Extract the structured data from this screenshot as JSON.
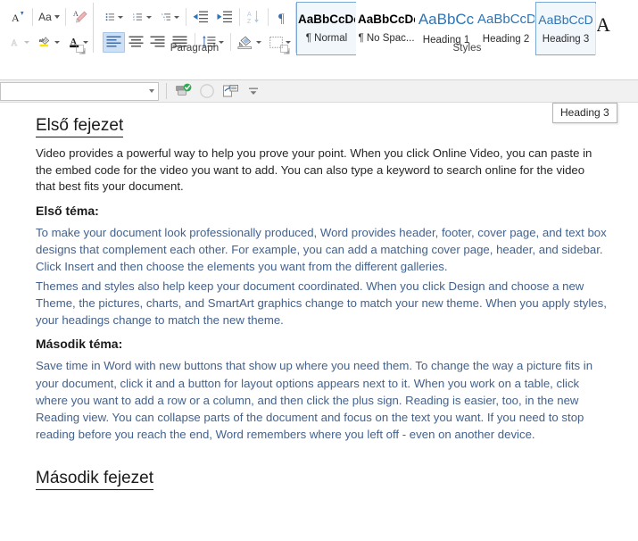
{
  "ribbon": {
    "font_group": {
      "buttons": [
        {
          "name": "grow-font-button",
          "label": "A",
          "icon": "grow-font-icon"
        },
        {
          "name": "change-case-button",
          "label": "Aa",
          "icon": "change-case-icon"
        },
        {
          "name": "clear-formatting-button",
          "label": "",
          "icon": "eraser-icon"
        },
        {
          "name": "text-effects-button",
          "label": "A",
          "icon": "text-effects-icon"
        },
        {
          "name": "text-highlight-color-button",
          "label": "ab",
          "icon": "highlighter-icon"
        },
        {
          "name": "font-color-button",
          "label": "A",
          "icon": "font-color-icon"
        }
      ]
    },
    "paragraph_group": {
      "caption": "Paragraph",
      "buttons": [
        {
          "name": "bullets-button",
          "icon": "bulleted-list-icon"
        },
        {
          "name": "numbering-button",
          "icon": "numbered-list-icon"
        },
        {
          "name": "multilevel-list-button",
          "icon": "multilevel-list-icon"
        },
        {
          "name": "decrease-indent-button",
          "icon": "decrease-indent-icon"
        },
        {
          "name": "increase-indent-button",
          "icon": "increase-indent-icon"
        },
        {
          "name": "sort-button",
          "icon": "sort-az-icon"
        },
        {
          "name": "show-formatting-marks-button",
          "icon": "pilcrow-icon"
        },
        {
          "name": "align-left-button",
          "icon": "align-left-icon"
        },
        {
          "name": "align-center-button",
          "icon": "align-center-icon"
        },
        {
          "name": "align-right-button",
          "icon": "align-right-icon"
        },
        {
          "name": "justify-button",
          "icon": "justify-icon"
        },
        {
          "name": "line-spacing-button",
          "icon": "line-spacing-icon"
        },
        {
          "name": "shading-button",
          "icon": "paint-bucket-icon"
        },
        {
          "name": "borders-button",
          "icon": "borders-icon"
        }
      ],
      "launcher_name": "paragraph-dialog-launcher"
    },
    "styles_group": {
      "caption": "Styles",
      "items": [
        {
          "preview": "AaBbCcDc",
          "label": "¶ Normal",
          "variant": "bold",
          "state": "hot"
        },
        {
          "preview": "AaBbCcDc",
          "label": "¶ No Spac...",
          "variant": "bold",
          "state": "idle"
        },
        {
          "preview": "AaBbCc",
          "label": "Heading 1",
          "variant": "h1",
          "state": "idle"
        },
        {
          "preview": "AaBbCcD",
          "label": "Heading 2",
          "variant": "h2",
          "state": "idle"
        },
        {
          "preview": "AaBbCcD",
          "label": "Heading 3",
          "variant": "h3",
          "state": "hot"
        },
        {
          "preview": "A",
          "label": "",
          "variant": "cut",
          "state": "idle"
        }
      ],
      "launcher_name": "styles-dialog-launcher"
    }
  },
  "toolbar2": {
    "combo_value": "",
    "combo_placeholder": "",
    "buttons": [
      {
        "name": "spelling-and-grammar-button",
        "icon": "spelling-check-icon"
      },
      {
        "name": "ellipse-shape-button",
        "icon": "circle-icon"
      },
      {
        "name": "insert-reference-button",
        "icon": "document-reference-icon"
      },
      {
        "name": "more-commands-button",
        "icon": "overflow-chevron-icon"
      }
    ]
  },
  "tooltip": {
    "text": "Heading 3"
  },
  "document": {
    "blocks": [
      {
        "type": "chapter-heading",
        "name": "chapter-heading-1",
        "text": "Első fejezet"
      },
      {
        "type": "paragraph-black",
        "name": "intro-paragraph",
        "text": "Video provides a powerful way to help you prove your point. When you click Online Video, you can paste in the embed code for the video you want to add. You can also type a keyword to search online for the video that best fits your document."
      },
      {
        "type": "topic-heading",
        "name": "topic-heading-1",
        "text": "Első téma:"
      },
      {
        "type": "paragraph-blue",
        "name": "topic-1-paragraph-1",
        "text": "To make your document look professionally produced, Word provides header, footer, cover page, and text box designs that complement each other. For example, you can add a matching cover page, header, and sidebar. Click Insert and then choose the elements you want from the different galleries."
      },
      {
        "type": "paragraph-blue",
        "name": "topic-1-paragraph-2",
        "text": "Themes and styles also help keep your document coordinated. When you click Design and choose a new Theme, the pictures, charts, and SmartArt graphics change to match your new theme. When you apply styles, your headings change to match the new theme."
      },
      {
        "type": "topic-heading",
        "name": "topic-heading-2",
        "text": "Második téma:"
      },
      {
        "type": "paragraph-blue",
        "name": "topic-2-paragraph-1",
        "text": "Save time in Word with new buttons that show up where you need them. To change the way a picture fits in your document, click it and a button for layout options appears next to it. When you work on a table, click where you want to add a row or a column, and then click the plus sign. Reading is easier, too, in the new Reading view. You can collapse parts of the document and focus on the text you want. If you need to stop reading before you reach the end, Word remembers where you left off - even on another device."
      },
      {
        "type": "chapter-heading",
        "name": "chapter-heading-2",
        "text": "Második fejezet"
      }
    ]
  },
  "colors": {
    "body_blue": "#43628d",
    "accent_blue": "#2e74b5",
    "selection_blue": "#cde0f5",
    "ribbon_bg": "#ffffff",
    "toolbar_bg": "#f1f1f1"
  }
}
